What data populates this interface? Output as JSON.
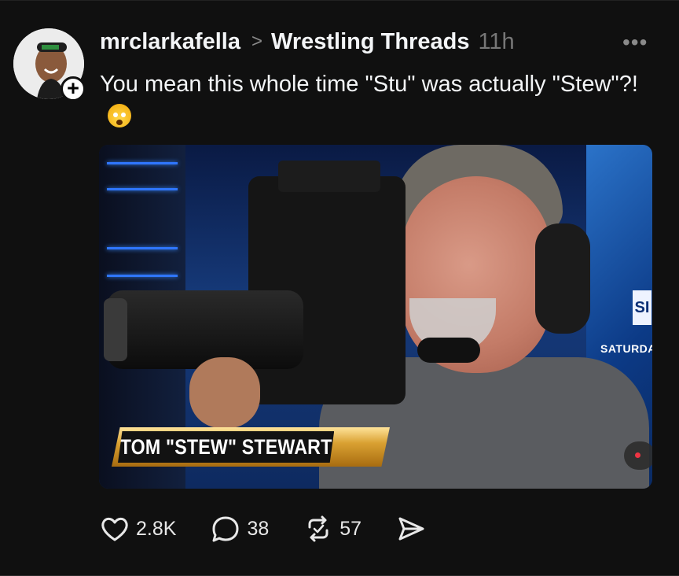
{
  "post": {
    "username": "mrclarkafella",
    "community": "Wrestling Threads",
    "time": "11h",
    "text": "You mean this whole time \"Stu\" was actually \"Stew\"?!",
    "emoji_name": "exploding-head-emoji",
    "image": {
      "lower_third": "TOM \"STEW\" STEWART",
      "sign_text": "SI",
      "background_text": "SATURDA"
    },
    "actions": {
      "likes": "2.8K",
      "replies": "38",
      "reposts": "57"
    }
  },
  "colors": {
    "background": "#101010",
    "text": "#f3f5f7",
    "muted": "#777777",
    "gold": "#d9a132"
  }
}
